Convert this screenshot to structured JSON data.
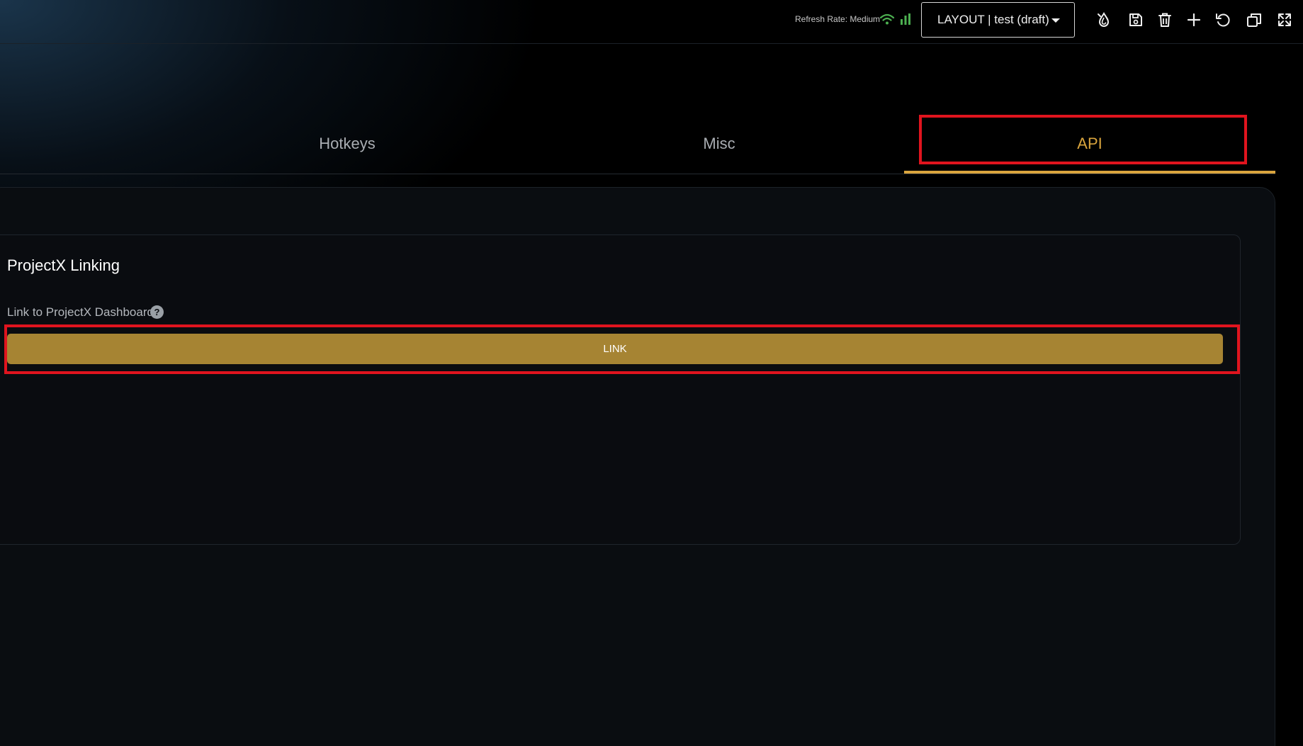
{
  "topbar": {
    "refresh_rate": "Refresh Rate: Medium",
    "layout_select": {
      "label": "LAYOUT | test (draft)"
    },
    "tools": [
      {
        "name": "theme-icon"
      },
      {
        "name": "save-icon"
      },
      {
        "name": "delete-icon"
      },
      {
        "name": "add-icon"
      },
      {
        "name": "undo-icon"
      },
      {
        "name": "window-icon"
      },
      {
        "name": "fullscreen-icon"
      }
    ]
  },
  "tabs": [
    {
      "label": "Hotkeys",
      "active": false
    },
    {
      "label": "Misc",
      "active": false
    },
    {
      "label": "API",
      "active": true
    }
  ],
  "card": {
    "title": "ProjectX Linking",
    "field_label": "Link to ProjectX Dashboard",
    "help_symbol": "?",
    "button_label": "LINK"
  },
  "colors": {
    "accent": "#d9a43d",
    "button": "#a68433",
    "highlight": "#e0141e",
    "signal": "#4caf50"
  }
}
